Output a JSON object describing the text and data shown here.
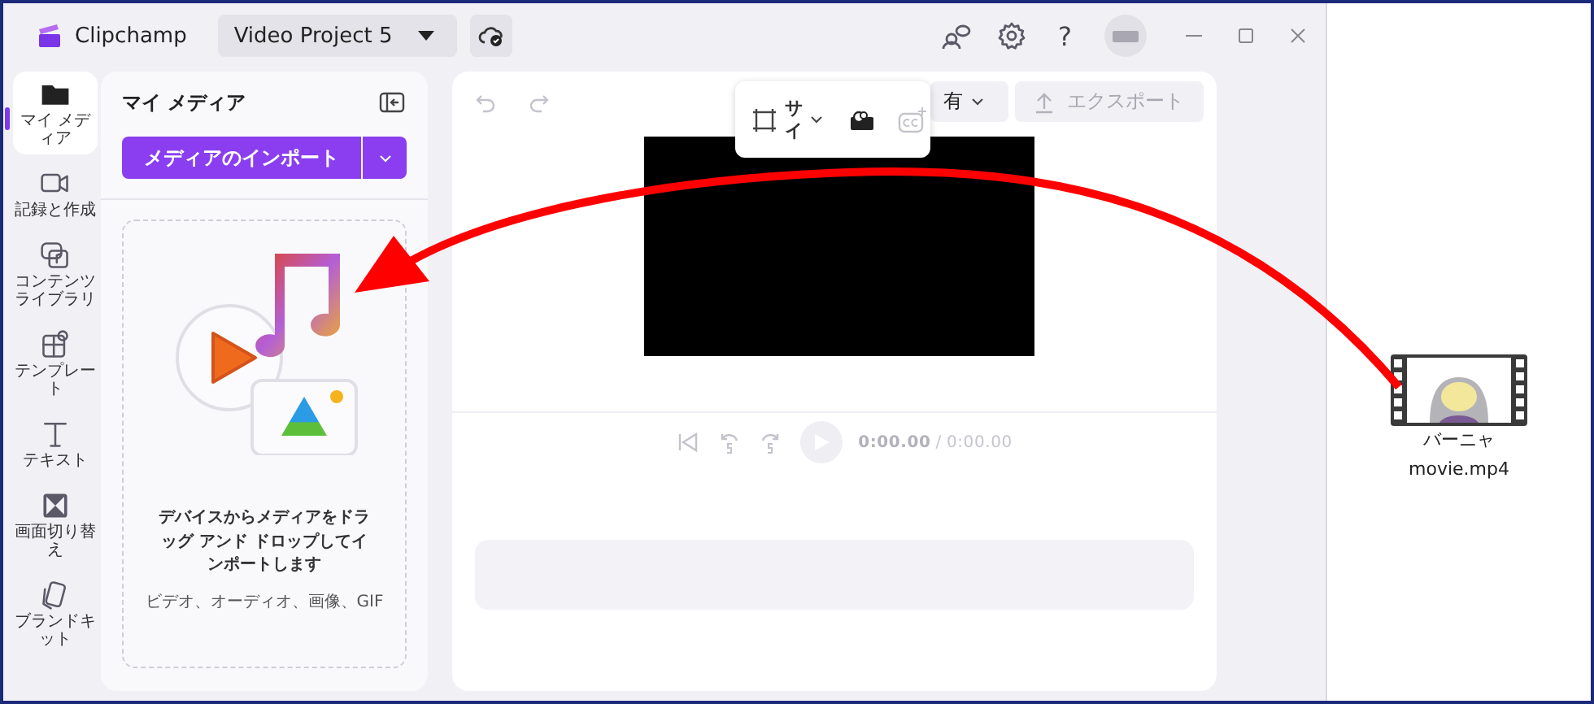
{
  "app": {
    "name": "Clipchamp"
  },
  "project": {
    "title": "Video Project 5"
  },
  "help": "?",
  "nav": [
    {
      "label": "マイ メディア",
      "kind": "folder",
      "selected": true
    },
    {
      "label": "記録と作成",
      "kind": "camera",
      "selected": false
    },
    {
      "label": "コンテンツライブラリ",
      "kind": "library",
      "selected": false
    },
    {
      "label": "テンプレート",
      "kind": "template",
      "selected": false
    },
    {
      "label": "テキスト",
      "kind": "text",
      "selected": false
    },
    {
      "label": "画面切り替え",
      "kind": "transition",
      "selected": false
    },
    {
      "label": "ブランドキット",
      "kind": "brand",
      "selected": false
    }
  ],
  "media_panel": {
    "title": "マイ メディア",
    "import_button": "メディアのインポート",
    "drop_message": "デバイスからメディアをドラッグ アンド ドロップしてインポートします",
    "drop_formats": "ビデオ、オーディオ、画像、GIF"
  },
  "editor": {
    "toolbar": {
      "size_label": "サイ"
    },
    "share_button": "有",
    "export_button": {
      "label": "エクスポート",
      "disabled": true
    },
    "player": {
      "current_time": "0:00.00",
      "separator": "/",
      "total_time": "0:00.00"
    }
  },
  "desktop_file": {
    "label": "バーニャ",
    "filename": "movie.mp4"
  }
}
